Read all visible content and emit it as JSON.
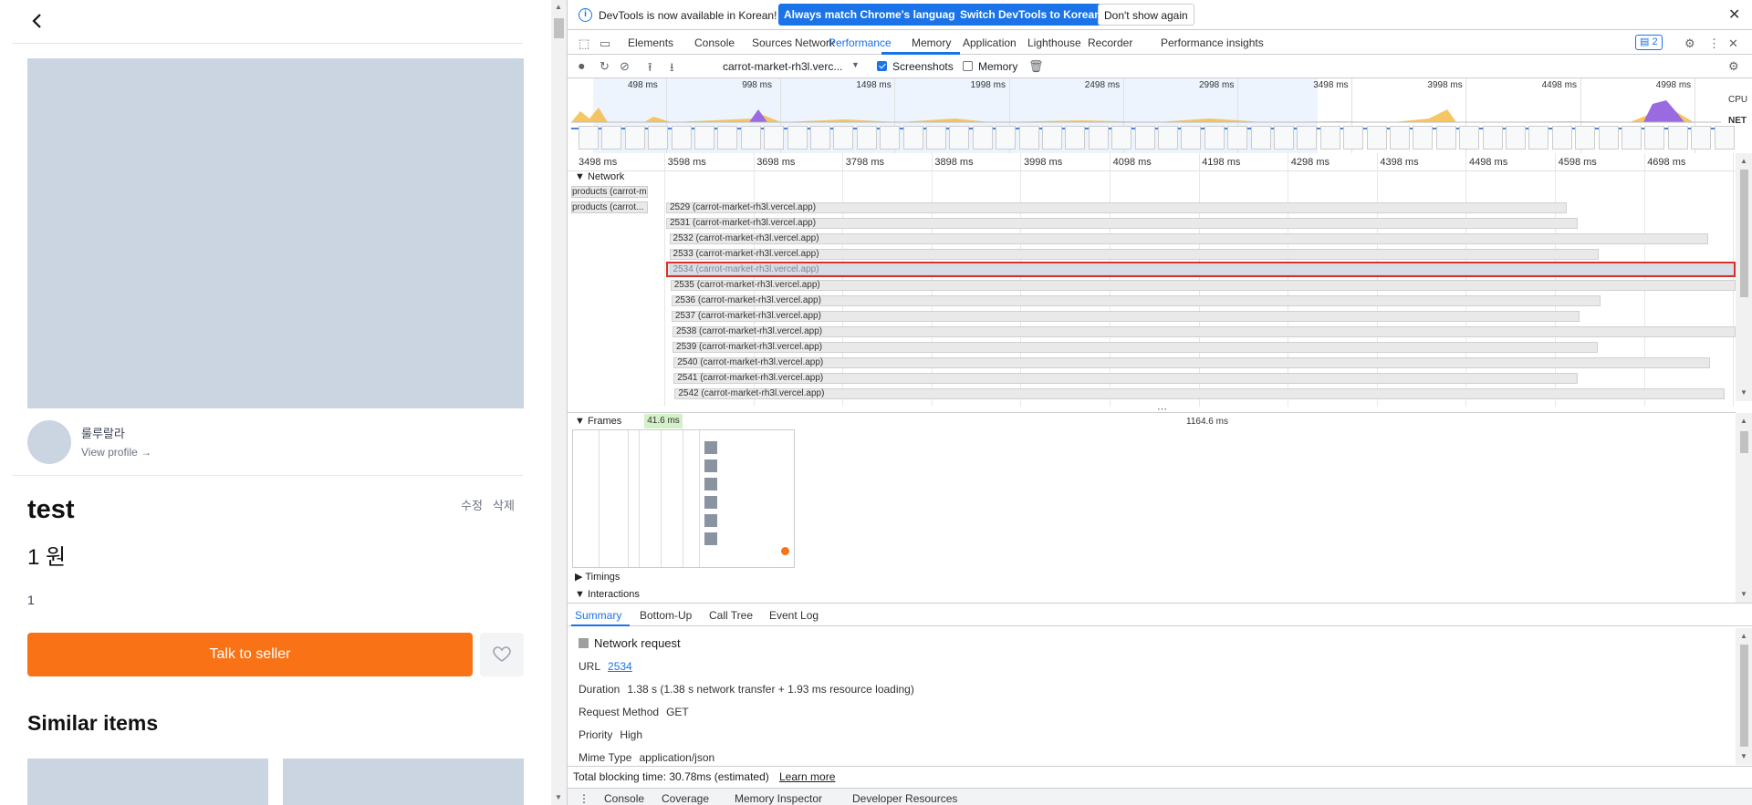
{
  "app": {
    "back_icon": "chevron-left-icon",
    "seller_name": "룰루랄라",
    "view_profile": "View profile →",
    "title": "test",
    "price": "1 원",
    "description": "1",
    "edit_label": "수정",
    "delete_label": "삭제",
    "talk_button": "Talk to seller",
    "favorite_icon": "heart-icon",
    "similar_heading": "Similar items"
  },
  "devtools": {
    "infobar": {
      "message": "DevTools is now available in Korean!",
      "btn_match": "Always match Chrome's language",
      "btn_switch": "Switch DevTools to Korean",
      "btn_dismiss": "Don't show again"
    },
    "tabs": [
      "Elements",
      "Console",
      "Sources",
      "Network",
      "Performance",
      "Memory",
      "Application",
      "Lighthouse",
      "Recorder",
      "Performance insights"
    ],
    "active_tab": "Performance",
    "issues_count": "2",
    "toolbar": {
      "target": "carrot-market-rh3l.verc...",
      "screenshots_label": "Screenshots",
      "screenshots_checked": true,
      "memory_label": "Memory",
      "memory_checked": false
    },
    "overview_ticks": [
      "498 ms",
      "998 ms",
      "1498 ms",
      "1998 ms",
      "2498 ms",
      "2998 ms",
      "3498 ms",
      "3998 ms",
      "4498 ms",
      "4998 ms"
    ],
    "cpu_label": "CPU",
    "net_label": "NET",
    "ruler_ticks": [
      "3498 ms",
      "3598 ms",
      "3698 ms",
      "3798 ms",
      "3898 ms",
      "3998 ms",
      "4098 ms",
      "4198 ms",
      "4298 ms",
      "4398 ms",
      "4498 ms",
      "4598 ms",
      "4698 ms"
    ],
    "network": {
      "heading": "Network",
      "parents": [
        "products (carrot-m...",
        "products (carrot..."
      ],
      "requests": [
        {
          "label": "2529 (carrot-market-rh3l.vercel.app)",
          "start": 0.0,
          "end": 0.842
        },
        {
          "label": "2531 (carrot-market-rh3l.vercel.app)",
          "start": 0.0,
          "end": 0.852
        },
        {
          "label": "2532 (carrot-market-rh3l.vercel.app)",
          "start": 0.003,
          "end": 0.974
        },
        {
          "label": "2533 (carrot-market-rh3l.vercel.app)",
          "start": 0.003,
          "end": 0.872
        },
        {
          "label": "2534 (carrot-market-rh3l.vercel.app)",
          "start": 0.003,
          "end": 1.0
        },
        {
          "label": "2535 (carrot-market-rh3l.vercel.app)",
          "start": 0.004,
          "end": 1.0
        },
        {
          "label": "2536 (carrot-market-rh3l.vercel.app)",
          "start": 0.005,
          "end": 0.874
        },
        {
          "label": "2537 (carrot-market-rh3l.vercel.app)",
          "start": 0.005,
          "end": 0.854
        },
        {
          "label": "2538 (carrot-market-rh3l.vercel.app)",
          "start": 0.006,
          "end": 1.0
        },
        {
          "label": "2539 (carrot-market-rh3l.vercel.app)",
          "start": 0.006,
          "end": 0.871
        },
        {
          "label": "2540 (carrot-market-rh3l.vercel.app)",
          "start": 0.007,
          "end": 0.976
        },
        {
          "label": "2541 (carrot-market-rh3l.vercel.app)",
          "start": 0.007,
          "end": 0.852
        },
        {
          "label": "2542 (carrot-market-rh3l.vercel.app)",
          "start": 0.008,
          "end": 0.99
        }
      ],
      "selected": "2534 (carrot-market-rh3l.vercel.app)"
    },
    "frames": {
      "heading": "Frames",
      "chip1": "41.6 ms",
      "chip2": "1164.6 ms"
    },
    "timings_label": "Timings",
    "interactions_label": "Interactions",
    "summary_tabs": [
      "Summary",
      "Bottom-Up",
      "Call Tree",
      "Event Log"
    ],
    "summary": {
      "title": "Network request",
      "url_label": "URL",
      "url_value": "2534",
      "duration_label": "Duration",
      "duration_value": "1.38 s (1.38 s network transfer + 1.93 ms resource loading)",
      "method_label": "Request Method",
      "method_value": "GET",
      "priority_label": "Priority",
      "priority_value": "High",
      "mime_label": "Mime Type",
      "mime_value": "application/json"
    },
    "tbt_text": "Total blocking time: 30.78ms (estimated)",
    "learn_more": "Learn more",
    "drawer_tabs": [
      "Console",
      "Coverage",
      "Memory Inspector",
      "Developer Resources"
    ]
  }
}
